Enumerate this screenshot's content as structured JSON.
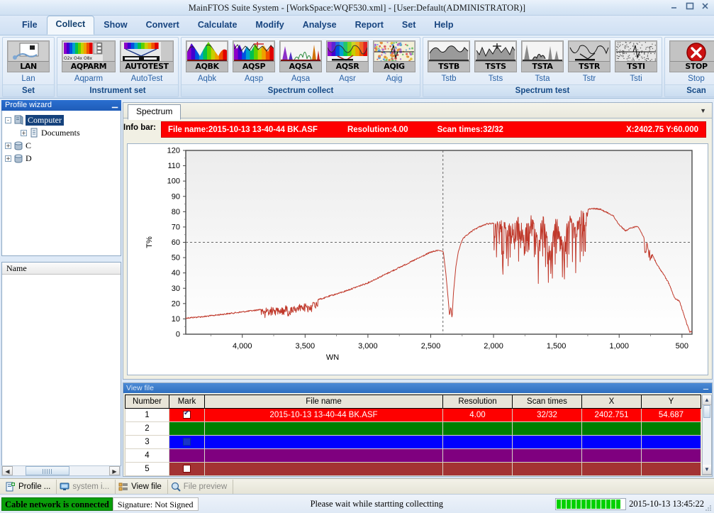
{
  "window": {
    "title": "MainFTOS Suite System - [WorkSpace:WQF530.xml] - [User:Default(ADMINISTRATOR)]",
    "minimize": "minimize-icon",
    "maximize": "maximize-icon",
    "close": "close-icon"
  },
  "menu": {
    "items": [
      {
        "label": "File",
        "active": false
      },
      {
        "label": "Collect",
        "active": true
      },
      {
        "label": "Show",
        "active": false
      },
      {
        "label": "Convert",
        "active": false
      },
      {
        "label": "Calculate",
        "active": false
      },
      {
        "label": "Modify",
        "active": false
      },
      {
        "label": "Analyse",
        "active": false
      },
      {
        "label": "Report",
        "active": false
      },
      {
        "label": "Set",
        "active": false
      },
      {
        "label": "Help",
        "active": false
      }
    ]
  },
  "ribbon": {
    "groups": [
      {
        "title": "Set",
        "buttons": [
          {
            "caption": "LAN",
            "label": "Lan",
            "icon": "lan-icon",
            "wide": false
          }
        ]
      },
      {
        "title": "Instrument set",
        "buttons": [
          {
            "caption": "AQPARM",
            "label": "Aqparm",
            "icon": "aqparm-icon",
            "wide": true
          },
          {
            "caption": "AUTOTEST",
            "label": "AutoTest",
            "icon": "autotest-icon",
            "wide": true
          }
        ]
      },
      {
        "title": "Spectrum collect",
        "buttons": [
          {
            "caption": "AQBK",
            "label": "Aqbk",
            "icon": "aqbk-icon",
            "wide": false
          },
          {
            "caption": "AQSP",
            "label": "Aqsp",
            "icon": "aqsp-icon",
            "wide": false
          },
          {
            "caption": "AQSA",
            "label": "Aqsa",
            "icon": "aqsa-icon",
            "wide": false
          },
          {
            "caption": "AQSR",
            "label": "Aqsr",
            "icon": "aqsr-icon",
            "wide": false
          },
          {
            "caption": "AQIG",
            "label": "Aqig",
            "icon": "aqig-icon",
            "wide": false
          }
        ]
      },
      {
        "title": "Spectrum test",
        "buttons": [
          {
            "caption": "TSTB",
            "label": "Tstb",
            "icon": "tstb-icon",
            "wide": false
          },
          {
            "caption": "TSTS",
            "label": "Tsts",
            "icon": "tsts-icon",
            "wide": false
          },
          {
            "caption": "TSTA",
            "label": "Tsta",
            "icon": "tsta-icon",
            "wide": false
          },
          {
            "caption": "TSTR",
            "label": "Tstr",
            "icon": "tstr-icon",
            "wide": false
          },
          {
            "caption": "TSTI",
            "label": "Tsti",
            "icon": "tsti-icon",
            "wide": false
          }
        ]
      },
      {
        "title": "Scan",
        "buttons": [
          {
            "caption": "STOP",
            "label": "Stop",
            "icon": "stop-icon",
            "wide": true
          }
        ]
      }
    ]
  },
  "sidebar": {
    "title": "Profile wizard",
    "pin": "▬",
    "tree": [
      {
        "label": "Computer",
        "expander": "-",
        "icon": "computer-icon",
        "level": 0,
        "selected": true
      },
      {
        "label": "Documents",
        "expander": "+",
        "icon": "documents-icon",
        "level": 1,
        "selected": false
      },
      {
        "label": "C",
        "expander": "+",
        "icon": "drive-icon",
        "level": 0,
        "selected": false
      },
      {
        "label": "D",
        "expander": "+",
        "icon": "drive-icon",
        "level": 0,
        "selected": false
      }
    ],
    "name_header": "Name"
  },
  "document": {
    "tab_label": "Spectrum",
    "infobar": {
      "prefix": "Info bar:",
      "file_name": "File name:2015-10-13 13-40-44 BK.ASF",
      "resolution": "Resolution:4.00",
      "scan_times": "Scan times:32/32",
      "coords": "X:2402.75 Y:60.000",
      "color": "#fe0000"
    }
  },
  "chart_data": {
    "type": "line",
    "title": "",
    "xlabel": "WN",
    "ylabel": "T%",
    "xlim": [
      4450,
      420
    ],
    "ylim": [
      0,
      120
    ],
    "x_ticks": [
      "4,000",
      "3,500",
      "3,000",
      "2,500",
      "2,000",
      "1,500",
      "1,000",
      "500"
    ],
    "x_tick_values": [
      4000,
      3500,
      3000,
      2500,
      2000,
      1500,
      1000,
      500
    ],
    "y_ticks": [
      "0",
      "10",
      "20",
      "30",
      "40",
      "50",
      "60",
      "70",
      "80",
      "90",
      "100",
      "110",
      "120"
    ],
    "y_tick_values": [
      0,
      10,
      20,
      30,
      40,
      50,
      60,
      70,
      80,
      90,
      100,
      110,
      120
    ],
    "grid": false,
    "series": [
      {
        "name": "2015-10-13 13-40-44 BK.ASF",
        "color": "#c0392b",
        "x": [
          4450,
          4300,
          4150,
          4000,
          3900,
          3800,
          3750,
          3700,
          3650,
          3620,
          3600,
          3570,
          3540,
          3520,
          3500,
          3470,
          3440,
          3420,
          3400,
          3350,
          3300,
          3200,
          3100,
          3000,
          2900,
          2800,
          2700,
          2600,
          2500,
          2450,
          2400,
          2380,
          2360,
          2350,
          2340,
          2330,
          2320,
          2300,
          2280,
          2260,
          2240,
          2200,
          2150,
          2100,
          2050,
          2000,
          1950,
          1900,
          1850,
          1800,
          1750,
          1700,
          1650,
          1600,
          1550,
          1500,
          1450,
          1400,
          1350,
          1300,
          1250,
          1200,
          1150,
          1100,
          1050,
          1000,
          950,
          900,
          850,
          800,
          750,
          700,
          650,
          600,
          560,
          520,
          480,
          440
        ],
        "y": [
          11,
          12,
          13.5,
          15,
          16,
          17.5,
          18,
          17,
          19,
          16.5,
          19.5,
          17,
          20,
          18,
          21,
          19,
          22,
          20.5,
          23,
          24,
          25.5,
          28,
          31,
          34,
          38,
          42,
          46,
          50,
          54,
          55,
          54,
          40,
          22,
          12,
          18,
          10,
          26,
          44,
          54,
          60,
          63,
          66,
          69,
          71,
          72.5,
          73,
          74,
          75,
          72,
          77,
          70,
          78,
          66,
          80,
          55,
          78,
          60,
          79,
          70,
          81,
          82,
          82.5,
          82,
          80,
          78,
          72,
          68,
          70,
          71,
          63,
          55,
          46,
          40,
          33,
          24,
          22,
          12,
          2
        ]
      }
    ],
    "crosshair": {
      "x": 2402.75,
      "y": 60.0,
      "style": "dashed",
      "color": "#666666"
    }
  },
  "viewfile": {
    "title": "View file",
    "pin": "▬",
    "columns": [
      "Number",
      "Mark",
      "File name",
      "Resolution",
      "Scan times",
      "X",
      "Y"
    ],
    "rows": [
      {
        "number": "1",
        "mark": "checked",
        "file_name": "2015-10-13 13-40-44 BK.ASF",
        "resolution": "4.00",
        "scan_times": "32/32",
        "x": "2402.751",
        "y": "54.687",
        "color": "#fe0000"
      },
      {
        "number": "2",
        "mark": "",
        "file_name": "",
        "resolution": "",
        "scan_times": "",
        "x": "",
        "y": "",
        "color": "#007f00"
      },
      {
        "number": "3",
        "mark": "empty-blue",
        "file_name": "",
        "resolution": "",
        "scan_times": "",
        "x": "",
        "y": "",
        "color": "#0000ff"
      },
      {
        "number": "4",
        "mark": "",
        "file_name": "",
        "resolution": "",
        "scan_times": "",
        "x": "",
        "y": "",
        "color": "#7f007f"
      },
      {
        "number": "5",
        "mark": "empty-red",
        "file_name": "",
        "resolution": "",
        "scan_times": "",
        "x": "",
        "y": "",
        "color": "#a33333"
      }
    ]
  },
  "bottom_tabs": [
    {
      "label": "Profile ...",
      "icon": "profile-icon",
      "dim": false
    },
    {
      "label": "system i...",
      "icon": "monitor-icon",
      "dim": true
    },
    {
      "label": "View file",
      "icon": "viewfile-icon",
      "dim": false
    },
    {
      "label": "File preview",
      "icon": "preview-icon",
      "dim": true
    }
  ],
  "statusbar": {
    "network": "Cable network is connected",
    "network_color": "#0a9e0a",
    "signature": "Signature: Not Signed",
    "message": "Please wait while startting collectting",
    "progress_segments": 13,
    "progress_color": "#00d000",
    "timestamp": "2015-10-13 13:45:22"
  }
}
